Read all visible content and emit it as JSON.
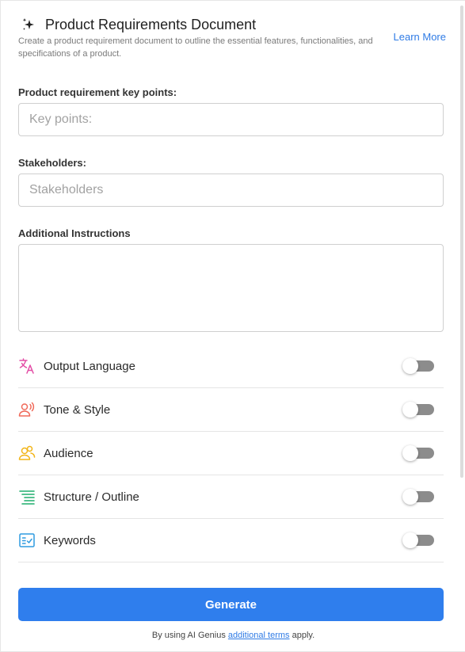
{
  "header": {
    "title": "Product Requirements Document",
    "subtitle": "Create a product requirement document to outline the essential features, functionalities, and specifications of a product.",
    "learn_more": "Learn More"
  },
  "form": {
    "key_points": {
      "label": "Product requirement key points:",
      "placeholder": "Key points:",
      "value": ""
    },
    "stakeholders": {
      "label": "Stakeholders:",
      "placeholder": "Stakeholders",
      "value": ""
    },
    "instructions": {
      "label": "Additional Instructions",
      "placeholder": "",
      "value": ""
    }
  },
  "options": [
    {
      "label": "Output Language",
      "icon": "translate-icon",
      "color": "#e34ea6",
      "enabled": false
    },
    {
      "label": "Tone & Style",
      "icon": "voice-person-icon",
      "color": "#f06a5a",
      "enabled": false
    },
    {
      "label": "Audience",
      "icon": "people-icon",
      "color": "#f2b51a",
      "enabled": false
    },
    {
      "label": "Structure / Outline",
      "icon": "outline-list-icon",
      "color": "#1fae6d",
      "enabled": false
    },
    {
      "label": "Keywords",
      "icon": "keyword-checklist-icon",
      "color": "#2f9be0",
      "enabled": false
    }
  ],
  "generate_label": "Generate",
  "footer": {
    "prefix": "By using AI Genius ",
    "link": "additional terms",
    "suffix": " apply."
  },
  "colors": {
    "accent": "#2f7eed",
    "toggle_off": "#8c8c8c"
  }
}
